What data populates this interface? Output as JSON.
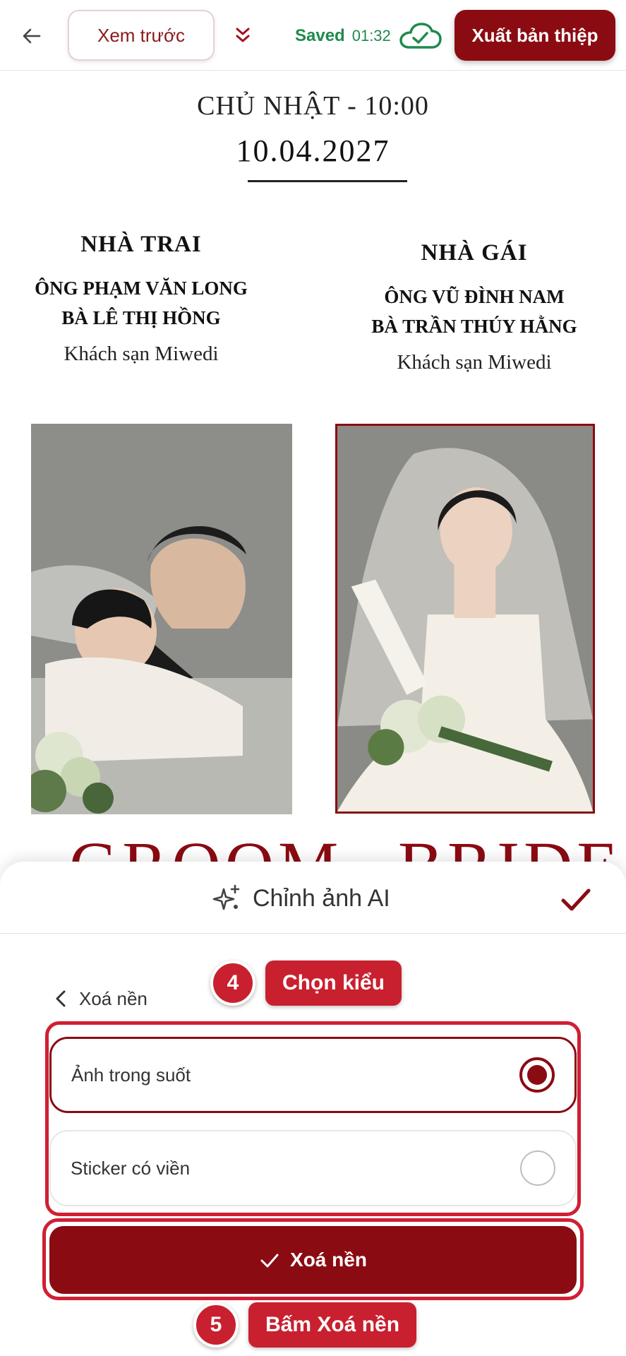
{
  "header": {
    "preview_label": "Xem trước",
    "saved_label": "Saved",
    "saved_time": "01:32",
    "export_label": "Xuất bản thiệp"
  },
  "card": {
    "day_time": "CHỦ NHẬT - 10:00",
    "date": "10.04.2027",
    "groom_family": {
      "title": "NHÀ TRAI",
      "father": "ÔNG PHẠM VĂN LONG",
      "mother": "BÀ LÊ THỊ HỒNG",
      "venue": "Khách sạn Miwedi"
    },
    "bride_family": {
      "title": "NHÀ GÁI",
      "father": "ÔNG VŨ ĐÌNH NAM",
      "mother": "BÀ TRẦN THÚY HẰNG",
      "venue": "Khách sạn Miwedi"
    },
    "groom_word": "GROOM",
    "bride_word": "BRIDE"
  },
  "sheet": {
    "title": "Chỉnh ảnh AI",
    "back_label": "Xoá nền",
    "options": [
      {
        "label": "Ảnh trong suốt",
        "selected": true
      },
      {
        "label": "Sticker có viền",
        "selected": false
      }
    ],
    "action_label": "Xoá nền"
  },
  "hints": {
    "step4_number": "4",
    "step4_label": "Chọn kiểu",
    "step5_number": "5",
    "step5_label": "Bấm Xoá nền"
  },
  "colors": {
    "brand": "#8b0b12",
    "saved_green": "#1f8a4c",
    "hint_red": "#c8202f"
  },
  "icons": [
    "back-arrow-icon",
    "double-chevron-down-icon",
    "cloud-check-icon",
    "sparkle-icon",
    "checkmark-icon",
    "chevron-left-icon"
  ]
}
